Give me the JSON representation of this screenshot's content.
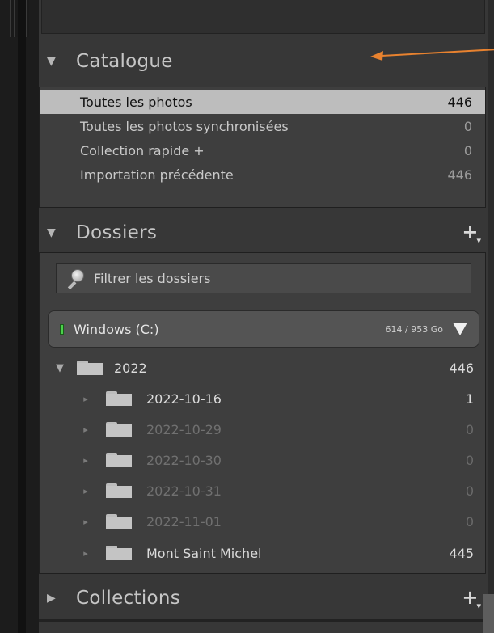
{
  "catalog": {
    "title": "Catalogue",
    "items": [
      {
        "label": "Toutes les photos",
        "count": "446"
      },
      {
        "label": "Toutes les photos synchronisées",
        "count": "0"
      },
      {
        "label": "Collection rapide +",
        "count": "0"
      },
      {
        "label": "Importation précédente",
        "count": "446"
      }
    ]
  },
  "folders": {
    "title": "Dossiers",
    "add_label": "+",
    "filter_placeholder": "Filtrer les dossiers",
    "volume": {
      "name": "Windows (C:)",
      "size": "614 / 953 Go"
    },
    "root": {
      "name": "2022",
      "count": "446"
    },
    "children": [
      {
        "name": "2022-10-16",
        "count": "1"
      },
      {
        "name": "2022-10-29",
        "count": "0"
      },
      {
        "name": "2022-10-30",
        "count": "0"
      },
      {
        "name": "2022-10-31",
        "count": "0"
      },
      {
        "name": "2022-11-01",
        "count": "0"
      },
      {
        "name": "Mont Saint Michel",
        "count": "445"
      }
    ]
  },
  "collections": {
    "title": "Collections",
    "add_label": "+"
  },
  "colors": {
    "annotation_arrow": "#e8822f",
    "drive_indicator": "#4bd14b",
    "selected_row": "#bdbdbd"
  }
}
